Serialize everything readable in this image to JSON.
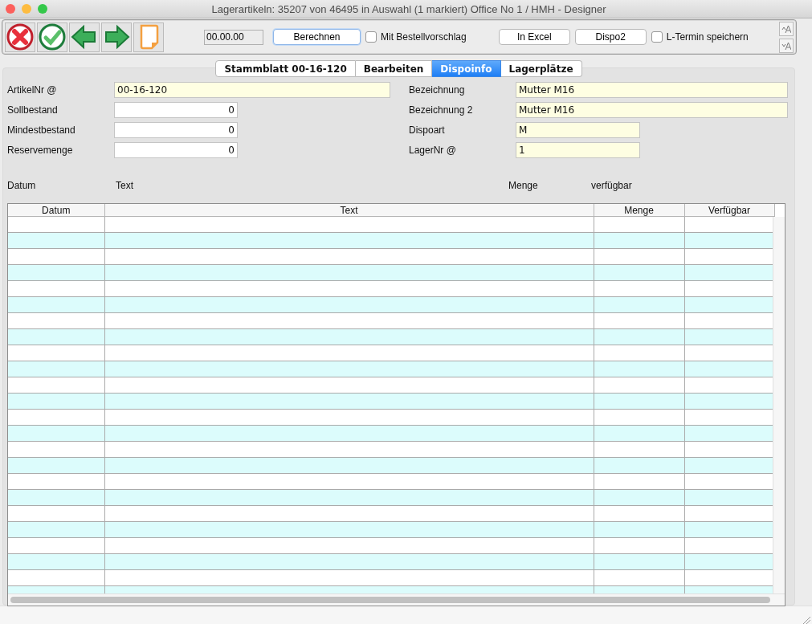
{
  "window": {
    "title": "Lagerartikeln: 35207 von 46495 in Auswahl  (1 markiert) Office No 1 /  HMH - Designer"
  },
  "toolbar": {
    "icon_buttons": [
      {
        "kind": "cancel"
      },
      {
        "kind": "confirm"
      },
      {
        "kind": "back"
      },
      {
        "kind": "forward"
      },
      {
        "kind": "new"
      }
    ],
    "controls": [
      {
        "kind": "field",
        "value": "00.00.00"
      },
      {
        "kind": "button",
        "label": "Berechnen",
        "default": true
      },
      {
        "kind": "checkbox",
        "label": "Mit Bestellvorschlag",
        "checked": false
      },
      {
        "kind": "button",
        "label": "In Excel",
        "default": false
      },
      {
        "kind": "button",
        "label": "Dispo2",
        "default": false
      },
      {
        "kind": "checkbox",
        "label": "L-Termin speichern",
        "checked": false
      }
    ]
  },
  "tabs": [
    {
      "label": "Stammblatt 00-16-120",
      "selected": false
    },
    {
      "label": "Bearbeiten",
      "selected": false
    },
    {
      "label": "Dispoinfo",
      "selected": true
    },
    {
      "label": "Lagerplätze",
      "selected": false
    }
  ],
  "form_left": [
    {
      "label": "ArtikelNr @",
      "value": "00-16-120",
      "kind": "wide",
      "readonly": true
    },
    {
      "label": "Sollbestand",
      "value": "0",
      "kind": "number",
      "readonly": false
    },
    {
      "label": "Mindestbestand",
      "value": "0",
      "kind": "number",
      "readonly": false
    },
    {
      "label": "Reservemenge",
      "value": "0",
      "kind": "number",
      "readonly": false
    }
  ],
  "form_right": [
    {
      "label": "Bezeichnung",
      "value": "Mutter M16",
      "kind": "wide",
      "readonly": true
    },
    {
      "label": "Bezeichnung 2",
      "value": "Mutter M16",
      "kind": "wide",
      "readonly": true
    },
    {
      "label": "Dispoart",
      "value": "M",
      "kind": "short",
      "readonly": true
    },
    {
      "label": "LagerNr @",
      "value": "1",
      "kind": "short",
      "readonly": true
    }
  ],
  "list_labels": [
    "Datum",
    "Text",
    "Menge",
    "verfügbar"
  ],
  "table": {
    "columns": [
      "Datum",
      "Text",
      "Menge",
      "Verfügbar"
    ]
  }
}
